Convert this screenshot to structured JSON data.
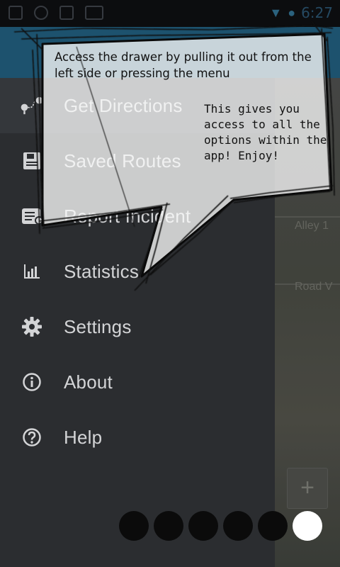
{
  "status_bar": {
    "time": "6:27",
    "icons": [
      "notification-icon",
      "usb-icon",
      "image-icon",
      "cast-icon",
      "wifi-icon",
      "signal-icon"
    ]
  },
  "drawer": {
    "items": [
      {
        "label": "Get Directions",
        "icon": "route-icon",
        "active": true
      },
      {
        "label": "Saved Routes",
        "icon": "save-icon",
        "active": false
      },
      {
        "label": "Report Incident",
        "icon": "report-icon",
        "active": false
      },
      {
        "label": "Statistics",
        "icon": "bar-chart-icon",
        "active": false
      },
      {
        "label": "Settings",
        "icon": "gear-icon",
        "active": false
      },
      {
        "label": "About",
        "icon": "info-icon",
        "active": false
      },
      {
        "label": "Help",
        "icon": "help-icon",
        "active": false
      }
    ]
  },
  "map": {
    "street_labels": [
      "Alley 1",
      "Road V"
    ],
    "zoom_in_label": "+"
  },
  "tutorial": {
    "bubble_main": "Access the drawer by pulling it out from the left side or pressing the menu",
    "bubble_secondary": "This gives you access to all the options within the app! Enjoy!",
    "pages_total": 6,
    "current_page": 6
  },
  "colors": {
    "drawer_bg": "#2e3033",
    "app_bar": "#1f5a78",
    "text": "#e9eaeb"
  }
}
